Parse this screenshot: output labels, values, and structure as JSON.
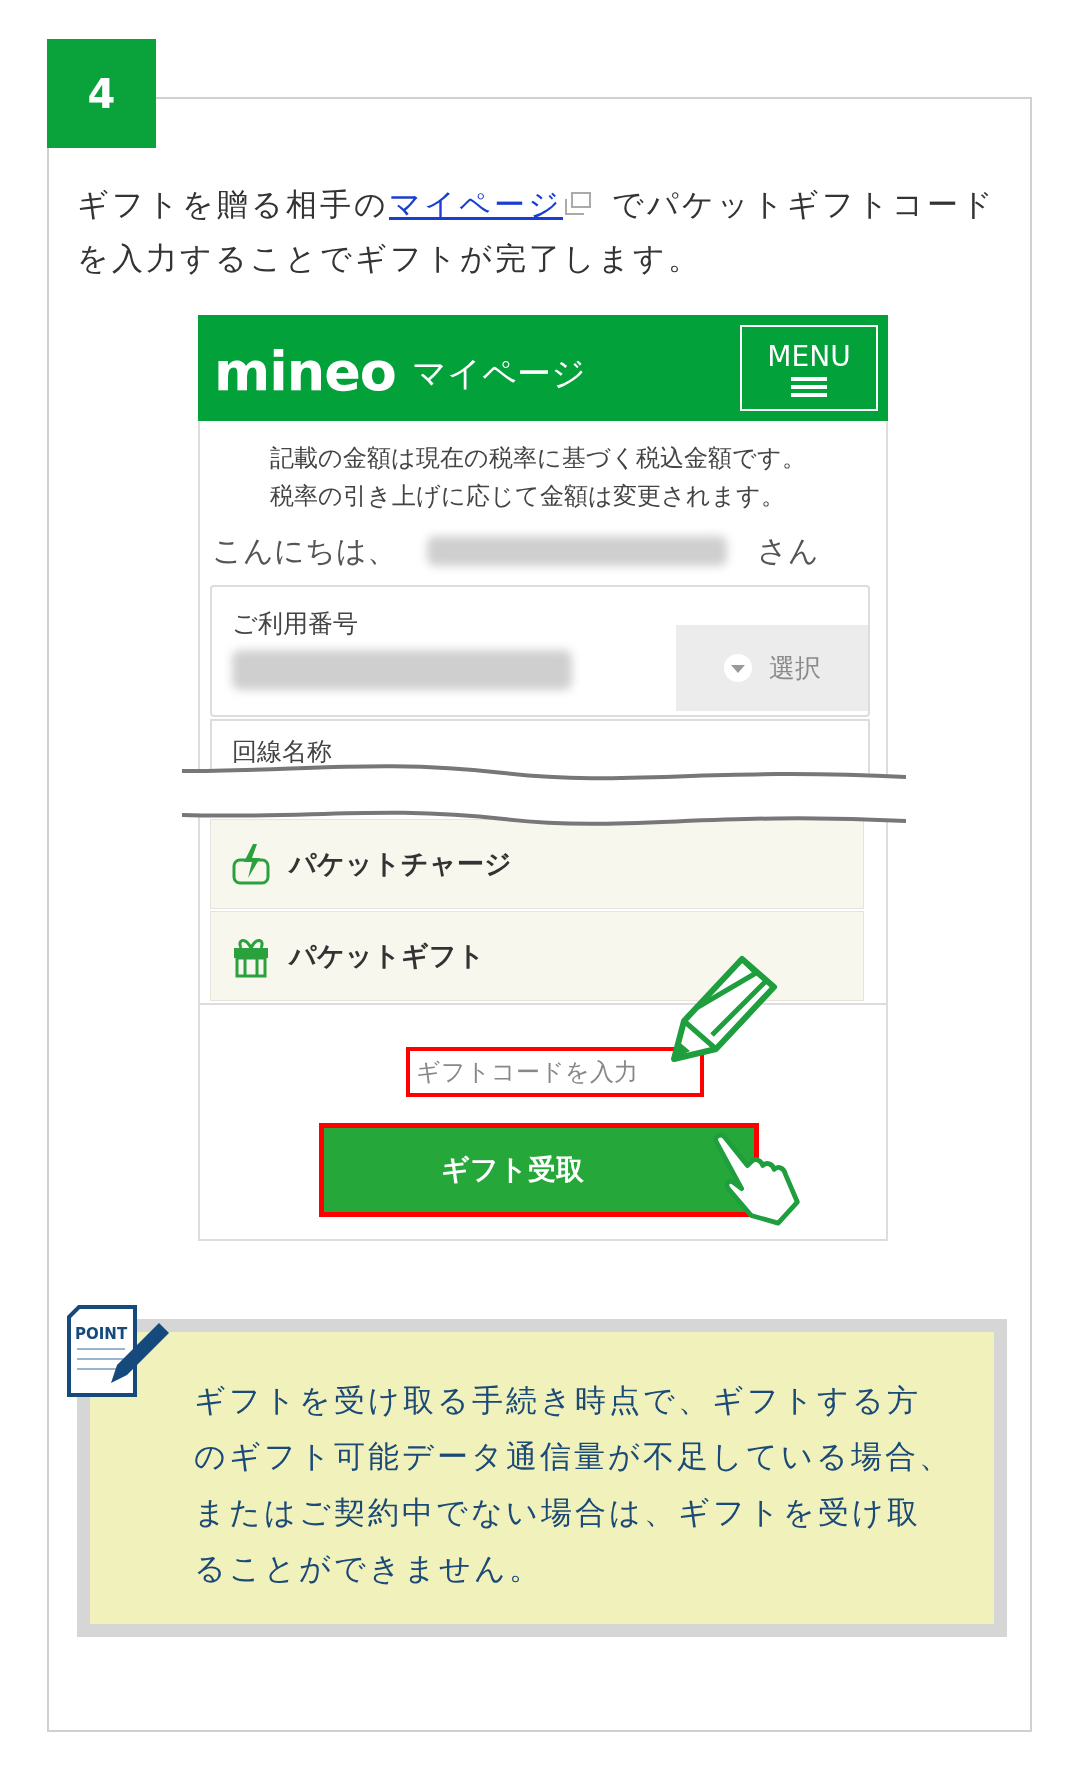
{
  "step": {
    "number": "4"
  },
  "intro": {
    "before": "ギフトを贈る相手の",
    "link": "マイページ",
    "after": " でパケットギフトコードを入力することでギフトが完了します。"
  },
  "screenshot": {
    "logo": "mineo",
    "title": "マイページ",
    "menu_button": "MENU",
    "notice": [
      "記載の金額は現在の税率に基づく税込金額です。",
      "税率の引き上げに応じて金額は変更されます。"
    ],
    "greeting_prefix": "こんにちは、",
    "greeting_suffix": "さん",
    "fields": [
      {
        "label": "ご利用番号",
        "select_button": "選択"
      },
      {
        "label": "回線名称"
      }
    ],
    "menu_items": [
      {
        "label": "パケットチャージ",
        "kind": "charge"
      },
      {
        "label": "パケットギフト",
        "kind": "gift"
      }
    ],
    "code_input": {
      "placeholder": "ギフトコードを入力"
    },
    "submit_button": "ギフト受取"
  },
  "point": {
    "badge": "POINT",
    "text": "ギフトを受け取る手続き時点で、ギフトする方のギフト可能データ通信量が不足している場合、またはご契約中でない場合は、ギフトを受け取ることができません。"
  }
}
